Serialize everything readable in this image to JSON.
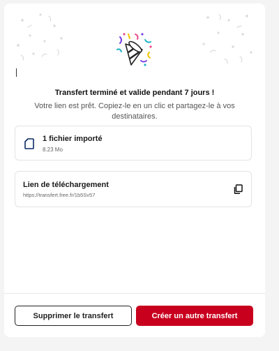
{
  "status": {
    "title": "Transfert terminé et valide pendant 7 jours !",
    "subtitle": "Votre lien est prêt. Copiez-le en un clic et partagez-le à vos destinataires."
  },
  "file": {
    "icon": "file-icon",
    "label": "1 fichier importé",
    "size": "8.23 Mo"
  },
  "link": {
    "label": "Lien de téléchargement",
    "url": "https://transfert.free.fr/1b5Sv57",
    "copy_icon": "copy-icon"
  },
  "actions": {
    "delete_label": "Supprimer le transfert",
    "new_label": "Créer un autre transfert"
  },
  "colors": {
    "primary": "#c8001e",
    "background": "#f4f4f4",
    "card": "#ffffff"
  }
}
